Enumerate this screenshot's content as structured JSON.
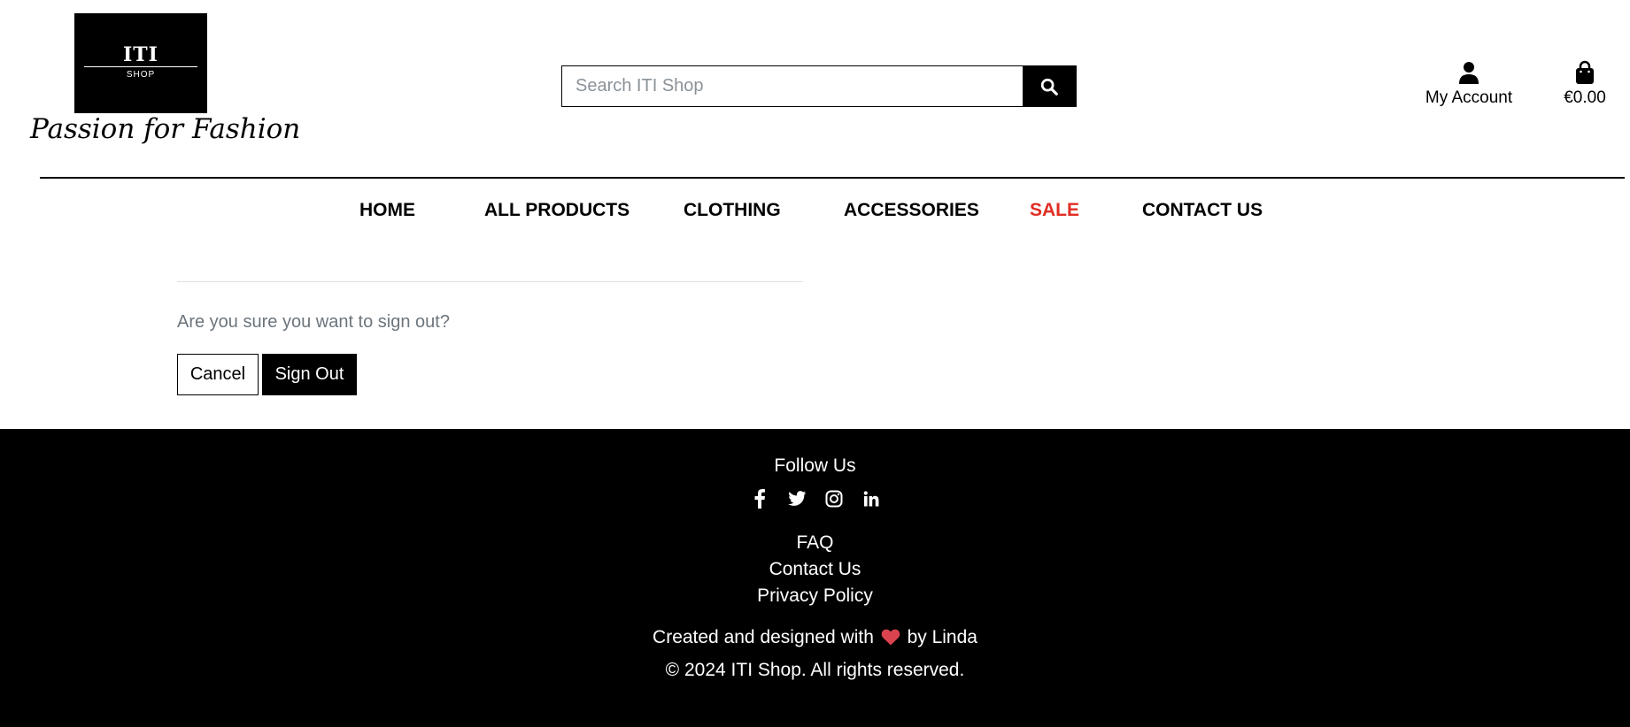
{
  "header": {
    "logo_main": "ITI",
    "logo_sub": "SHOP",
    "tagline": "Passion for Fashion",
    "search_placeholder": "Search ITI Shop",
    "account_label": "My Account",
    "bag_total": "€0.00"
  },
  "nav": {
    "items": [
      "HOME",
      "ALL PRODUCTS",
      "CLOTHING",
      "ACCESSORIES",
      "SALE",
      "CONTACT US"
    ]
  },
  "main": {
    "confirm_text": "Are you sure you want to sign out?",
    "cancel_label": "Cancel",
    "signout_label": "Sign Out"
  },
  "footer": {
    "follow_heading": "Follow Us",
    "socials": [
      "facebook-icon",
      "twitter-icon",
      "instagram-icon",
      "linkedin-icon"
    ],
    "links": [
      "FAQ",
      "Contact Us",
      "Privacy Policy"
    ],
    "credit_before": "Created and designed with",
    "credit_after": "by Linda",
    "copyright": "© 2024 ITI Shop. All rights reserved."
  },
  "colors": {
    "sale": "#e02e24",
    "heart": "#d9434f"
  }
}
